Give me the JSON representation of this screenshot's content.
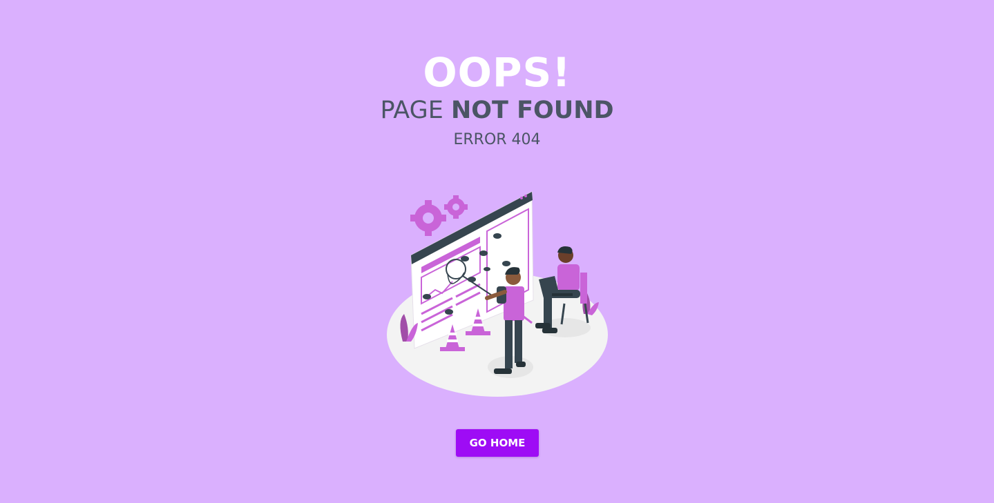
{
  "hero": {
    "title": "OOPS!",
    "subtitle_light": "PAGE",
    "subtitle_bold": "NOT FOUND",
    "error_code": "ERROR 404"
  },
  "actions": {
    "home_label": "GO HOME"
  },
  "colors": {
    "background": "#dab0fe",
    "title": "#ffffff",
    "text": "#4b5565",
    "button": "#9e0cf5",
    "illustration_accent": "#c964d8",
    "illustration_dark": "#36454f"
  },
  "illustration": {
    "icon": "bug-hunting-illustration"
  }
}
